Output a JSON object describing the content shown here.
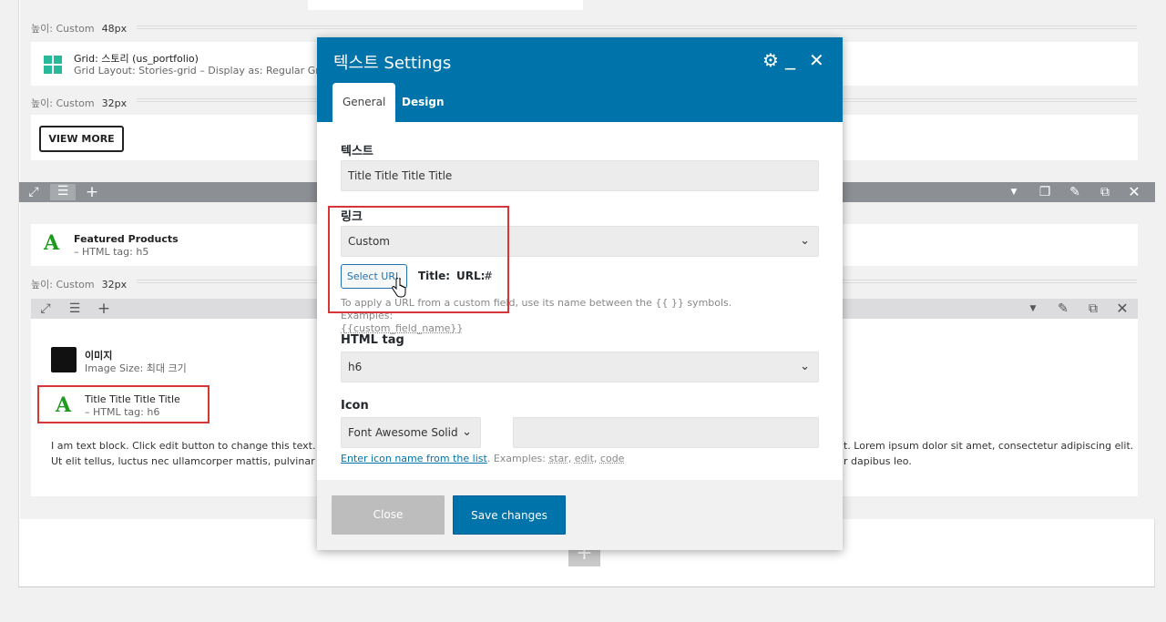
{
  "builder": {
    "spacer1": {
      "label": "높이: Custom",
      "value": "48px"
    },
    "grid": {
      "title": "Grid: 스토리 (us_portfolio)",
      "sub": "Grid Layout: Stories-grid  –  Display as: Regular Grid  –"
    },
    "spacer2": {
      "label": "높이: Custom",
      "value": "32px"
    },
    "view_more": "VIEW MORE",
    "featured": {
      "title": "Featured Products",
      "sub": "– HTML tag: h5"
    },
    "spacer3": {
      "label": "높이: Custom",
      "value": "32px"
    },
    "image": {
      "title": "이미지",
      "sub": "Image Size: 최대 크기"
    },
    "text_el": {
      "title": "Title Title Title Title",
      "sub": "– HTML tag: h6"
    },
    "text_block": {
      "line1_left": "I am text block. Click edit button to change this text. Lorem",
      "line2_left": "Ut elit tellus, luctus nec ullamcorper mattis, pulvinar dapib",
      "line1_right": "t. Lorem ipsum dolor sit amet, consectetur adipiscing elit.",
      "line2_right": "r dapibus leo."
    },
    "add_icon": "+"
  },
  "modal": {
    "title": "텍스트 Settings",
    "tabs": [
      "General",
      "Design"
    ],
    "fields": {
      "text_label": "텍스트",
      "text_value": "Title Title Title Title",
      "link_label": "링크",
      "link_value": "Custom",
      "select_url": "Select URL",
      "title_label": "Title:",
      "url_label": "URL:",
      "url_value": "#",
      "hint": "To apply a URL from a custom field, use its name between the {{ }} symbols. Examples:",
      "hint_example": "{{custom_field_name}}",
      "html_tag_label": "HTML tag",
      "html_tag_value": "h6",
      "icon_label": "Icon",
      "icon_set_value": "Font Awesome Solid",
      "icon_name_value": "",
      "icon_link": "Enter icon name from the list",
      "icon_examples_prefix": ". Examples:",
      "icon_examples": [
        "star",
        "edit",
        "code"
      ]
    },
    "buttons": {
      "close": "Close",
      "save": "Save changes"
    }
  },
  "colors": {
    "accent": "#0073aa",
    "highlight": "#d63638",
    "icon_green": "#1e9a1e",
    "grid_teal": "#28b99a"
  },
  "icons": [
    "gear-icon",
    "minimize-icon",
    "close-icon",
    "expand-icon",
    "drag-handle-icon",
    "plus-icon",
    "chevron-down-icon",
    "copy-icon",
    "pencil-icon",
    "duplicate-icon",
    "hand-cursor-icon"
  ]
}
